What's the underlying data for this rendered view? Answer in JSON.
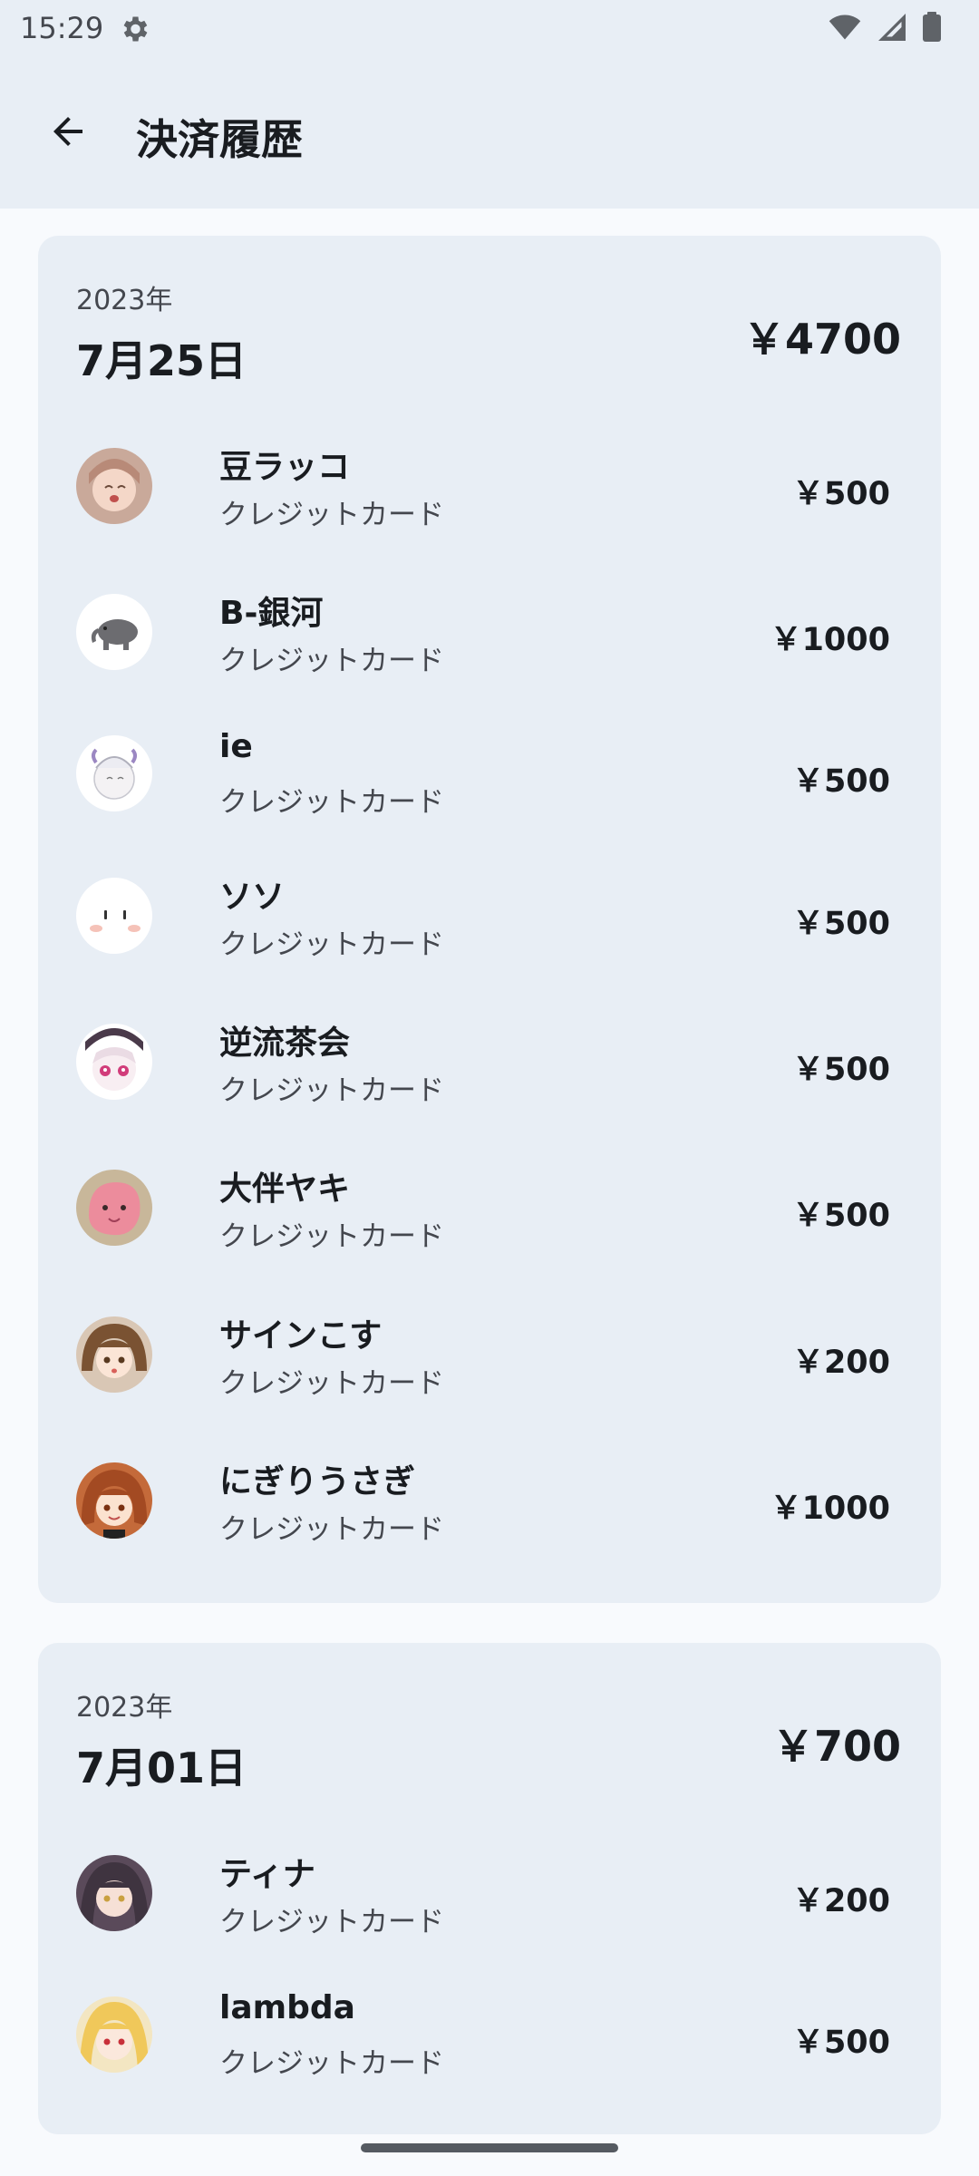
{
  "status_bar": {
    "time": "15:29"
  },
  "app_bar": {
    "title": "決済履歴"
  },
  "groups": [
    {
      "year": "2023年",
      "date": "7月25日",
      "total": "￥4700",
      "items": [
        {
          "name": "豆ラッコ",
          "method": "クレジットカード",
          "amount": "￥500"
        },
        {
          "name": "B-銀河",
          "method": "クレジットカード",
          "amount": "￥1000"
        },
        {
          "name": "ie",
          "method": "クレジットカード",
          "amount": "￥500"
        },
        {
          "name": "ソソ",
          "method": "クレジットカード",
          "amount": "￥500"
        },
        {
          "name": "逆流茶会",
          "method": "クレジットカード",
          "amount": "￥500"
        },
        {
          "name": "大伴ヤキ",
          "method": "クレジットカード",
          "amount": "￥500"
        },
        {
          "name": "サインこす",
          "method": "クレジットカード",
          "amount": "￥200"
        },
        {
          "name": "にぎりうさぎ",
          "method": "クレジットカード",
          "amount": "￥1000"
        }
      ]
    },
    {
      "year": "2023年",
      "date": "7月01日",
      "total": "￥700",
      "items": [
        {
          "name": "ティナ",
          "method": "クレジットカード",
          "amount": "￥200"
        },
        {
          "name": "lambda",
          "method": "クレジットカード",
          "amount": "￥500"
        }
      ]
    }
  ],
  "colors": {
    "surface": "#e8eef5",
    "background": "#f8fafd",
    "on_surface": "#191c20",
    "on_surface_variant": "#44474e"
  },
  "icons": {
    "back": "arrow-back-icon",
    "settings": "gear-icon",
    "wifi": "wifi-icon",
    "signal": "cell-signal-icon",
    "battery": "battery-icon"
  }
}
